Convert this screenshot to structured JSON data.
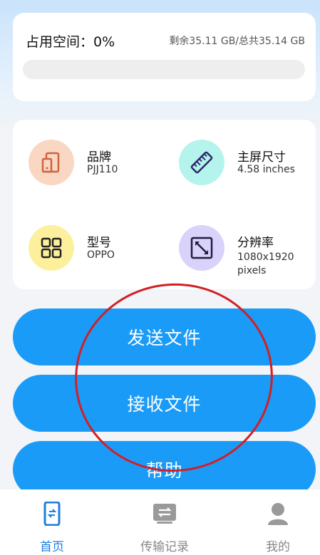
{
  "storage": {
    "title": "占用空间：0%",
    "detail": "剩余35.11 GB/总共35.14 GB",
    "used_fraction": 0.0
  },
  "device_info": [
    {
      "label": "品牌",
      "value": "PJJ110",
      "icon": "tablet-phone-icon",
      "circle_color": "#fad7c2",
      "icon_color": "#d0633f"
    },
    {
      "label": "主屏尺寸",
      "value": "4.58 inches",
      "icon": "ruler-icon",
      "circle_color": "#b5f4ec",
      "icon_color": "#2c2c6c"
    },
    {
      "label": "型号",
      "value": "OPPO",
      "icon": "grid-icon",
      "circle_color": "#fdf09d",
      "icon_color": "#222222"
    },
    {
      "label": "分辨率",
      "value": "1080x1920 pixels",
      "icon": "resize-icon",
      "circle_color": "#d9d2fa",
      "icon_color": "#1f1f3f"
    }
  ],
  "actions": {
    "send": "发送文件",
    "receive": "接收文件",
    "help": "帮助"
  },
  "nav": {
    "home": "首页",
    "history": "传输记录",
    "me": "我的"
  },
  "colors": {
    "primary": "#1a9bf7",
    "nav_active": "#1a7fe0",
    "annotation": "#d21f25"
  }
}
